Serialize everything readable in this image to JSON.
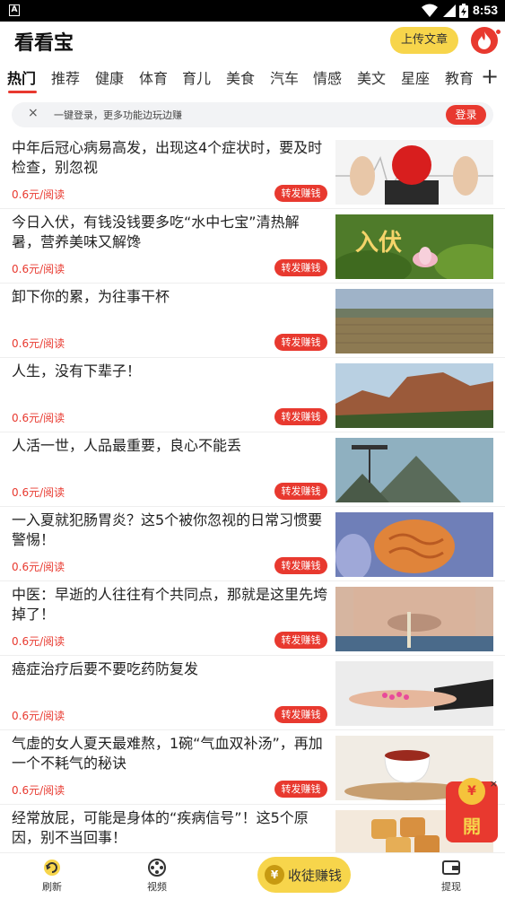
{
  "status": {
    "badge": "A",
    "time": "8:53"
  },
  "app": {
    "title": "看看宝",
    "upload_label": "上传文章"
  },
  "tabs": [
    "热门",
    "推荐",
    "健康",
    "体育",
    "育儿",
    "美食",
    "汽车",
    "情感",
    "美文",
    "星座",
    "教育"
  ],
  "tab_add_label": "+",
  "login_bar": {
    "close": "×",
    "message": "一键登录，更多功能边玩边赚",
    "button": "登录"
  },
  "feed": [
    {
      "title": "中年后冠心病易高发，出现这4个症状时，要及时检查，别忽视",
      "reward": "0.6元/阅读",
      "share": "转发赚钱"
    },
    {
      "title": "今日入伏，有钱没钱要多吃“水中七宝”清热解暑，营养美味又解馋",
      "reward": "0.6元/阅读",
      "share": "转发赚钱",
      "thumb_text": "入伏"
    },
    {
      "title": "卸下你的累，为往事干杯",
      "reward": "0.6元/阅读",
      "share": "转发赚钱"
    },
    {
      "title": "人生，没有下辈子！",
      "reward": "0.6元/阅读",
      "share": "转发赚钱"
    },
    {
      "title": "人活一世，人品最重要，良心不能丢",
      "reward": "0.6元/阅读",
      "share": "转发赚钱"
    },
    {
      "title": "一入夏就犯肠胃炎？这5个被你忽视的日常习惯要警惕！",
      "reward": "0.6元/阅读",
      "share": "转发赚钱"
    },
    {
      "title": "中医：早逝的人往往有个共同点，那就是这里先垮掉了！",
      "reward": "0.6元/阅读",
      "share": "转发赚钱"
    },
    {
      "title": "癌症治疗后要不要吃药防复发",
      "reward": "0.6元/阅读",
      "share": "转发赚钱"
    },
    {
      "title": "气虚的女人夏天最难熬，1碗“气血双补汤”，再加一个不耗气的秘诀",
      "reward": "0.6元/阅读",
      "share": "转发赚钱"
    },
    {
      "title": "经常放屁，可能是身体的“疾病信号”！这5个原因，别不当回事！",
      "reward": "",
      "share": ""
    }
  ],
  "redpack": {
    "close": "×",
    "coin": "¥",
    "label": "開"
  },
  "bottom_nav": {
    "refresh": "刷新",
    "video": "视频",
    "recruit": "收徒赚钱",
    "recruit_coin": "¥",
    "withdraw": "提现"
  },
  "colors": {
    "accent": "#e8392f",
    "yellow": "#f7d54b"
  }
}
